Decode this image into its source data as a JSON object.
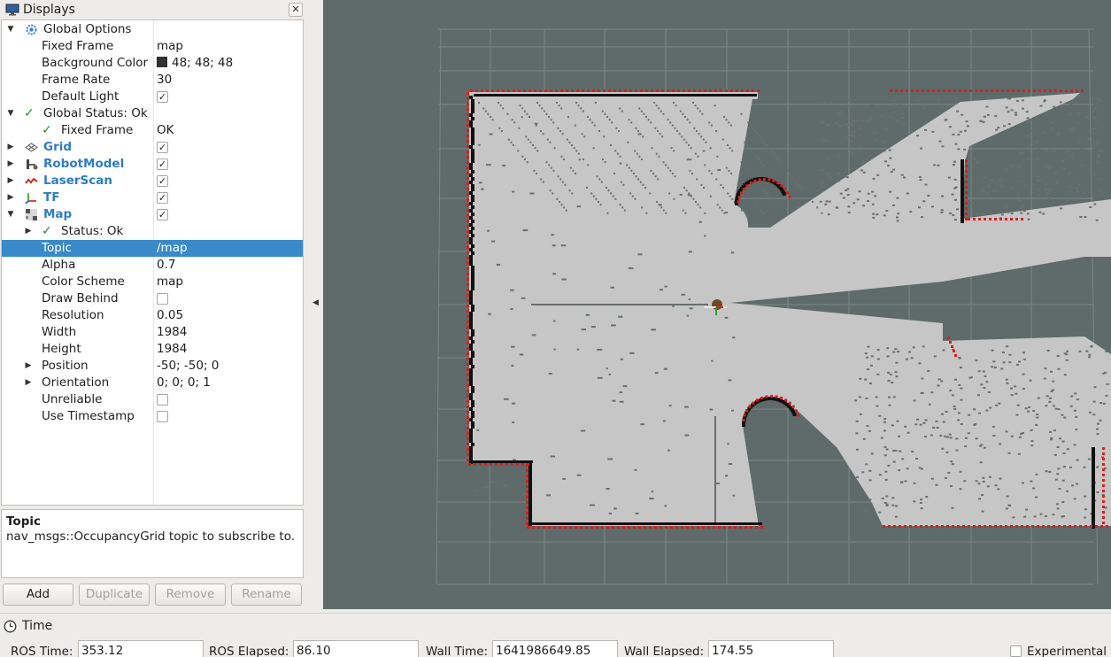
{
  "displays": {
    "title": "Displays",
    "close_glyph": "✕",
    "rows": [
      {
        "label": "Global Options",
        "arrow": "▼",
        "icon": "gear-icon"
      },
      {
        "label": "Fixed Frame",
        "value": "map"
      },
      {
        "label": "Background Color",
        "value": "48; 48; 48",
        "color": "#303030"
      },
      {
        "label": "Frame Rate",
        "value": "30"
      },
      {
        "label": "Default Light",
        "checked": true
      },
      {
        "label": "Global Status: Ok",
        "arrow": "▼",
        "icon": "check-icon"
      },
      {
        "label": "Fixed Frame",
        "value": "OK",
        "icon": "check-icon"
      },
      {
        "label": "Grid",
        "arrow": "▶",
        "icon": "grid-icon",
        "checked": true
      },
      {
        "label": "RobotModel",
        "arrow": "▶",
        "icon": "robot-model-icon",
        "checked": true
      },
      {
        "label": "LaserScan",
        "arrow": "▶",
        "icon": "laser-scan-icon",
        "checked": true
      },
      {
        "label": "TF",
        "arrow": "▶",
        "icon": "tf-icon",
        "checked": true
      },
      {
        "label": "Map",
        "arrow": "▼",
        "icon": "map-icon",
        "checked": true
      },
      {
        "label": "Status: Ok",
        "arrow": "▶",
        "icon": "check-icon"
      },
      {
        "label": "Topic",
        "value": "/map",
        "selected": true
      },
      {
        "label": "Alpha",
        "value": "0.7"
      },
      {
        "label": "Color Scheme",
        "value": "map"
      },
      {
        "label": "Draw Behind",
        "checked": false
      },
      {
        "label": "Resolution",
        "value": "0.05"
      },
      {
        "label": "Width",
        "value": "1984"
      },
      {
        "label": "Height",
        "value": "1984"
      },
      {
        "label": "Position",
        "arrow": "▶",
        "value": "-50; -50; 0"
      },
      {
        "label": "Orientation",
        "arrow": "▶",
        "value": "0; 0; 0; 1"
      },
      {
        "label": "Unreliable",
        "checked": false
      },
      {
        "label": "Use Timestamp",
        "checked": false
      }
    ],
    "description": {
      "title": "Topic",
      "text": "nav_msgs::OccupancyGrid topic to subscribe to."
    },
    "buttons": {
      "add": "Add",
      "duplicate": "Duplicate",
      "remove": "Remove",
      "rename": "Rename"
    }
  },
  "view": {
    "background_color": "#5e6b6a",
    "map_free_color": "#c6c6c6",
    "obstacle_color": "#111111",
    "laser_color": "#e01a1a"
  },
  "time": {
    "title": "Time",
    "ros_time_label": "ROS Time:",
    "ros_time": "353.12",
    "ros_elapsed_label": "ROS Elapsed:",
    "ros_elapsed": "86.10",
    "wall_time_label": "Wall Time:",
    "wall_time": "1641986649.85",
    "wall_elapsed_label": "Wall Elapsed:",
    "wall_elapsed": "174.55",
    "experimental_label": "Experimental",
    "experimental_checked": false
  }
}
